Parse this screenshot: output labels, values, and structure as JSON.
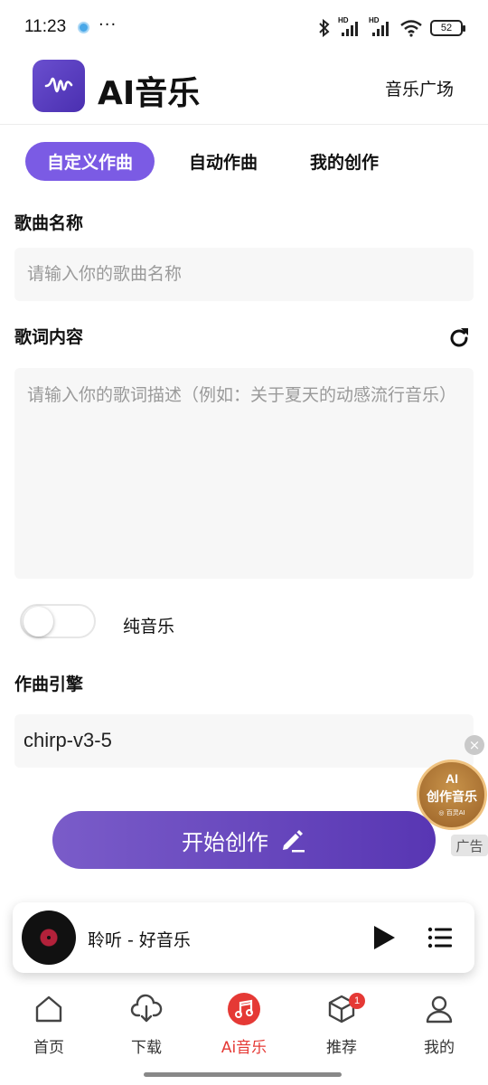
{
  "status_bar": {
    "time": "11:23",
    "more": "···",
    "battery": "52",
    "network_label": "HD"
  },
  "header": {
    "title": "AI音乐",
    "plaza_link": "音乐广场",
    "logo_icon": "waveform-icon"
  },
  "tabs": [
    {
      "label": "自定义作曲",
      "active": true
    },
    {
      "label": "自动作曲",
      "active": false
    },
    {
      "label": "我的创作",
      "active": false
    }
  ],
  "form": {
    "song_name_label": "歌曲名称",
    "song_name_placeholder": "请输入你的歌曲名称",
    "lyrics_label": "歌词内容",
    "lyrics_placeholder": "请输入你的歌词描述（例如：关于夏天的动感流行音乐）",
    "instrumental_label": "纯音乐",
    "instrumental_on": false,
    "engine_label": "作曲引擎",
    "engine_value": "chirp-v3-5",
    "submit_label": "开始创作"
  },
  "ad": {
    "line1": "AI",
    "line2": "创作音乐",
    "line3": "◎ 百灵AI",
    "tag": "广告",
    "close": "×"
  },
  "player": {
    "title": "聆听 - 好音乐"
  },
  "nav": [
    {
      "label": "首页",
      "icon": "home-icon",
      "active": false
    },
    {
      "label": "下载",
      "icon": "cloud-download-icon",
      "active": false
    },
    {
      "label": "Ai音乐",
      "icon": "music-note-icon",
      "active": true
    },
    {
      "label": "推荐",
      "icon": "cube-icon",
      "active": false,
      "badge": "1"
    },
    {
      "label": "我的",
      "icon": "person-icon",
      "active": false
    }
  ],
  "colors": {
    "accent": "#7b5be4",
    "nav_active": "#e53935",
    "button_start": "#7a5cc9",
    "button_end": "#5836b3"
  }
}
